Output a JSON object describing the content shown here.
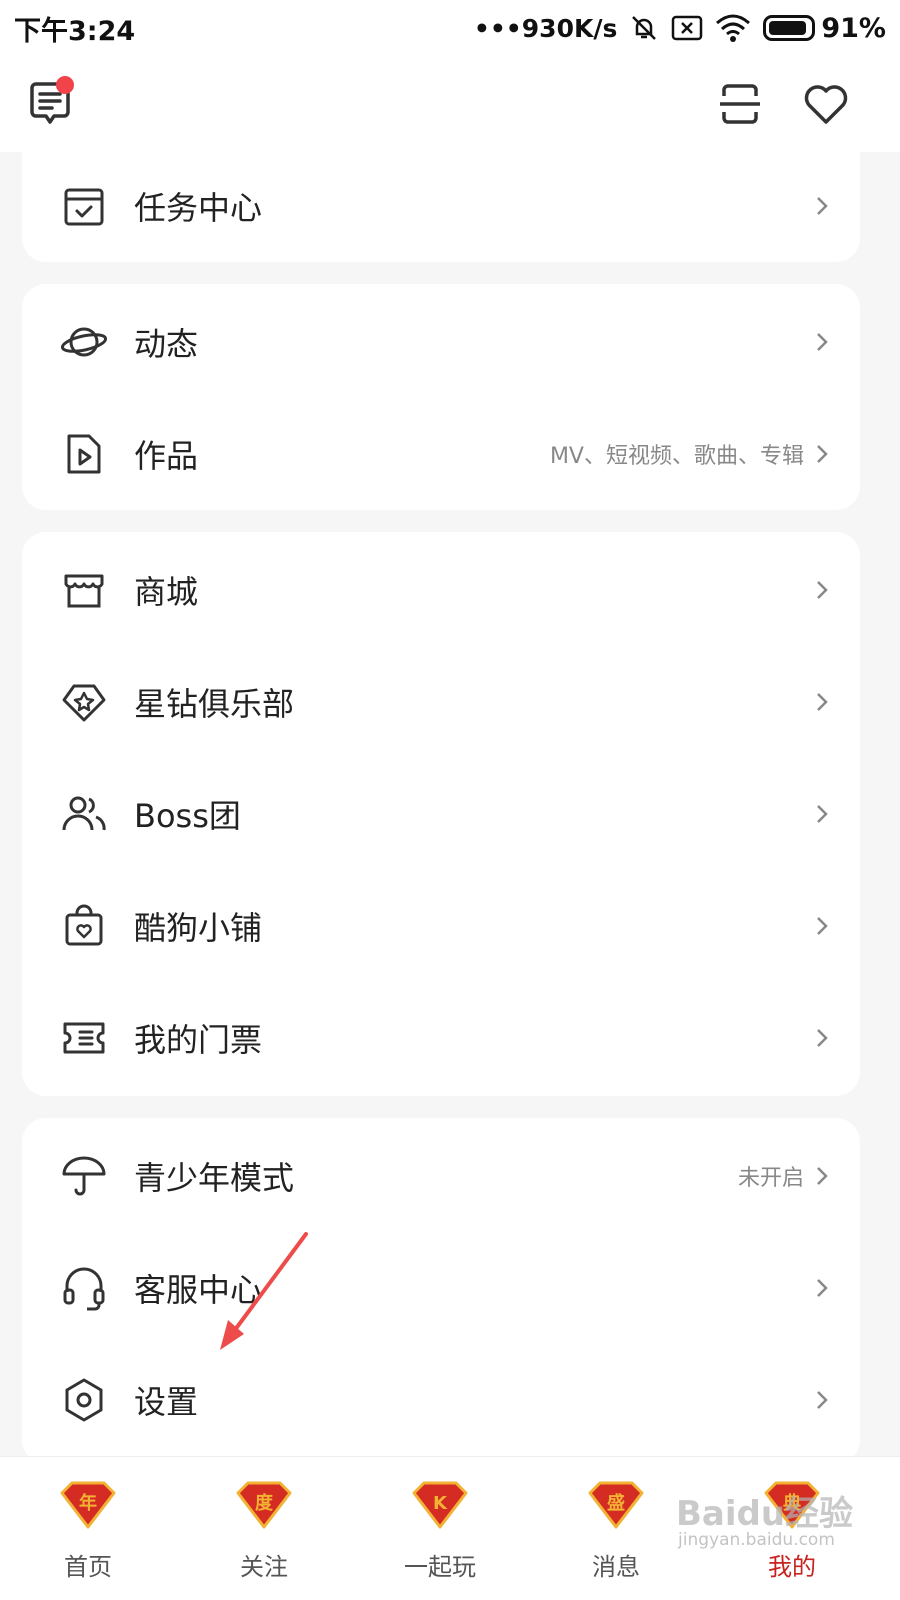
{
  "status_bar": {
    "time": "下午3:24",
    "net_speed": "•••930K/s",
    "battery": "91%",
    "battery_level": 0.91,
    "icons": [
      "mute-icon",
      "sim-off-icon",
      "wifi-icon",
      "battery-icon"
    ]
  },
  "top_bar": {
    "icons": [
      "message-icon",
      "scan-icon",
      "heart-icon"
    ],
    "notification_dot_color": "#f1434a"
  },
  "cards": [
    {
      "items": [
        {
          "label": "任务中心",
          "icon": "task-calendar-icon",
          "sub": ""
        }
      ]
    },
    {
      "items": [
        {
          "label": "动态",
          "icon": "planet-icon",
          "sub": ""
        },
        {
          "label": "作品",
          "icon": "video-file-icon",
          "sub": "MV、短视频、歌曲、专辑"
        }
      ]
    },
    {
      "items": [
        {
          "label": "商城",
          "icon": "store-icon",
          "sub": ""
        },
        {
          "label": "星钻俱乐部",
          "icon": "diamond-star-icon",
          "sub": ""
        },
        {
          "label": "Boss团",
          "icon": "users-icon",
          "sub": ""
        },
        {
          "label": "酷狗小铺",
          "icon": "shop-bag-icon",
          "sub": ""
        },
        {
          "label": "我的门票",
          "icon": "ticket-icon",
          "sub": ""
        }
      ]
    },
    {
      "items": [
        {
          "label": "青少年模式",
          "icon": "umbrella-icon",
          "sub": "未开启"
        },
        {
          "label": "客服中心",
          "icon": "headset-icon",
          "sub": ""
        },
        {
          "label": "设置",
          "icon": "settings-hex-icon",
          "sub": ""
        }
      ]
    }
  ],
  "tabs": [
    {
      "label": "首页",
      "badge_char": "年",
      "active": false
    },
    {
      "label": "关注",
      "badge_char": "度",
      "active": false
    },
    {
      "label": "一起玩",
      "badge_char": "K",
      "active": false
    },
    {
      "label": "消息",
      "badge_char": "盛",
      "active": false
    },
    {
      "label": "我的",
      "badge_char": "典",
      "active": true
    }
  ],
  "watermark": {
    "logo": "Baidu经验",
    "sub": "jingyan.baidu.com"
  },
  "colors": {
    "accent_red": "#c8221f",
    "badge_red": "#d42b22",
    "badge_gold": "#f2b233",
    "icon_gray": "#333333",
    "arrow_red": "#ee4b4b"
  }
}
